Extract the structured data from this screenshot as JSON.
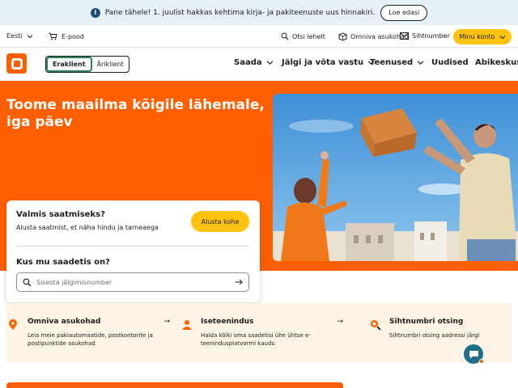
{
  "notice": {
    "info_icon": "info-icon",
    "text": "Pane tähele! 1. juulist hakkas kehtima kirja- ja pakiteenuste uus hinnakiri.",
    "button": "Loe edasi"
  },
  "util": {
    "language": "Eesti",
    "shop": "E-pood",
    "search": "Otsi lehelt",
    "parcel_locations": "Omniva asukohad",
    "postcode": "Sihtnumber",
    "account": "Minu konto"
  },
  "nav": {
    "segments": [
      "Eraklient",
      "Äriklient"
    ],
    "menu": [
      "Saada",
      "Jälgi ja võta vastu",
      "Teenused",
      "Uudised",
      "Abikeskus"
    ]
  },
  "hero": {
    "title": "Toome maailma kõigile lähemale, iga päev"
  },
  "card": {
    "ready_title": "Valmis saatmiseks?",
    "ready_sub": "Alusta saatmist, et näha hindu ja tarneaega",
    "start_button": "Alusta kohe",
    "where_title": "Kus mu saadetis on?",
    "tracking_placeholder": "Sisesta jälgimisnumber"
  },
  "quick": [
    {
      "title": "Omniva asukohad",
      "desc": "Leia meie pakiautomaatide, postkontorite ja postipunktide asukohad",
      "icon": "map-pin-icon"
    },
    {
      "title": "Iseteenindus",
      "desc": "Halda kõiki oma saadetisi ühe ühtse e-teenindusplatvormi kaudu",
      "icon": "person-icon"
    },
    {
      "title": "Sihtnumbri otsing",
      "desc": "Sihtnumbri otsing aadressi järgi",
      "icon": "magnifier-icon"
    }
  ],
  "colors": {
    "brand_orange": "#ff5f00",
    "accent_yellow": "#ffc20e",
    "notice_bg": "#e6f1f8",
    "quick_bg": "#fdf4e6"
  }
}
